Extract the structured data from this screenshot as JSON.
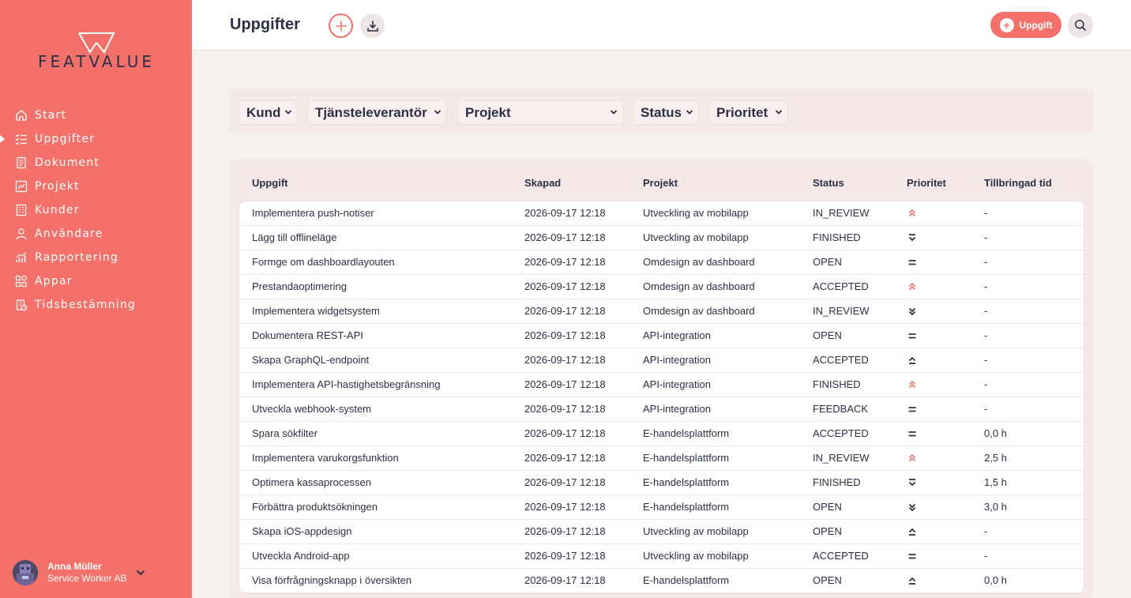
{
  "app": {
    "logo_text": "FEATVALUE",
    "accent_color": "#f3716a",
    "dark_color": "#2c2f45"
  },
  "sidebar": {
    "items": [
      {
        "label": "Start",
        "icon": "home-icon",
        "active": false
      },
      {
        "label": "Uppgifter",
        "icon": "tasks-icon",
        "active": true
      },
      {
        "label": "Dokument",
        "icon": "document-icon",
        "active": false
      },
      {
        "label": "Projekt",
        "icon": "project-icon",
        "active": false
      },
      {
        "label": "Kunder",
        "icon": "building-icon",
        "active": false
      },
      {
        "label": "Användare",
        "icon": "user-icon",
        "active": false
      },
      {
        "label": "Rapportering",
        "icon": "chart-icon",
        "active": false
      },
      {
        "label": "Appar",
        "icon": "apps-icon",
        "active": false
      },
      {
        "label": "Tidsbestämning",
        "icon": "timesheet-icon",
        "active": false
      }
    ],
    "user": {
      "name": "Anna Müller",
      "company": "Service Worker AB"
    }
  },
  "header": {
    "title": "Uppgifter",
    "new_task_label": "Uppgift"
  },
  "filters": [
    "Kund",
    "Tjänsteleverantör",
    "Projekt",
    "Status",
    "Prioritet"
  ],
  "table": {
    "columns": [
      "Uppgift",
      "Skapad",
      "Projekt",
      "Status",
      "Prioritet",
      "Tillbringad tid"
    ],
    "rows": [
      {
        "task": "Implementera push-notiser",
        "created": "2026-09-17 12:18",
        "project": "Utveckling av mobilapp",
        "status": "IN_REVIEW",
        "priority": "highest",
        "time": "-"
      },
      {
        "task": "Lägg till offlineläge",
        "created": "2026-09-17 12:18",
        "project": "Utveckling av mobilapp",
        "status": "FINISHED",
        "priority": "lowest",
        "time": "-"
      },
      {
        "task": "Formge om dashboardlayouten",
        "created": "2026-09-17 12:18",
        "project": "Omdesign av dashboard",
        "status": "OPEN",
        "priority": "medium",
        "time": "-"
      },
      {
        "task": "Prestandaoptimering",
        "created": "2026-09-17 12:18",
        "project": "Omdesign av dashboard",
        "status": "ACCEPTED",
        "priority": "highest",
        "time": "-"
      },
      {
        "task": "Implementera widgetsystem",
        "created": "2026-09-17 12:18",
        "project": "Omdesign av dashboard",
        "status": "IN_REVIEW",
        "priority": "low",
        "time": "-"
      },
      {
        "task": "Dokumentera REST-API",
        "created": "2026-09-17 12:18",
        "project": "API-integration",
        "status": "OPEN",
        "priority": "medium",
        "time": "-"
      },
      {
        "task": "Skapa GraphQL-endpoint",
        "created": "2026-09-17 12:18",
        "project": "API-integration",
        "status": "ACCEPTED",
        "priority": "high",
        "time": "-"
      },
      {
        "task": "Implementera API-hastighetsbegränsning",
        "created": "2026-09-17 12:18",
        "project": "API-integration",
        "status": "FINISHED",
        "priority": "highest",
        "time": "-"
      },
      {
        "task": "Utveckla webhook-system",
        "created": "2026-09-17 12:18",
        "project": "API-integration",
        "status": "FEEDBACK",
        "priority": "medium",
        "time": "-"
      },
      {
        "task": "Spara sökfilter",
        "created": "2026-09-17 12:18",
        "project": "E-handelsplattform",
        "status": "ACCEPTED",
        "priority": "medium",
        "time": "0,0 h"
      },
      {
        "task": "Implementera varukorgsfunktion",
        "created": "2026-09-17 12:18",
        "project": "E-handelsplattform",
        "status": "IN_REVIEW",
        "priority": "highest",
        "time": "2,5 h"
      },
      {
        "task": "Optimera kassaprocessen",
        "created": "2026-09-17 12:18",
        "project": "E-handelsplattform",
        "status": "FINISHED",
        "priority": "lowest",
        "time": "1,5 h"
      },
      {
        "task": "Förbättra produktsökningen",
        "created": "2026-09-17 12:18",
        "project": "E-handelsplattform",
        "status": "OPEN",
        "priority": "low",
        "time": "3,0 h"
      },
      {
        "task": "Skapa iOS-appdesign",
        "created": "2026-09-17 12:18",
        "project": "Utveckling av mobilapp",
        "status": "OPEN",
        "priority": "high",
        "time": "-"
      },
      {
        "task": "Utveckla Android-app",
        "created": "2026-09-17 12:18",
        "project": "Utveckling av mobilapp",
        "status": "ACCEPTED",
        "priority": "medium",
        "time": "-"
      },
      {
        "task": "Visa förfrågningsknapp i översikten",
        "created": "2026-09-17 12:18",
        "project": "E-handelsplattform",
        "status": "OPEN",
        "priority": "high",
        "time": "0,0 h"
      }
    ]
  }
}
